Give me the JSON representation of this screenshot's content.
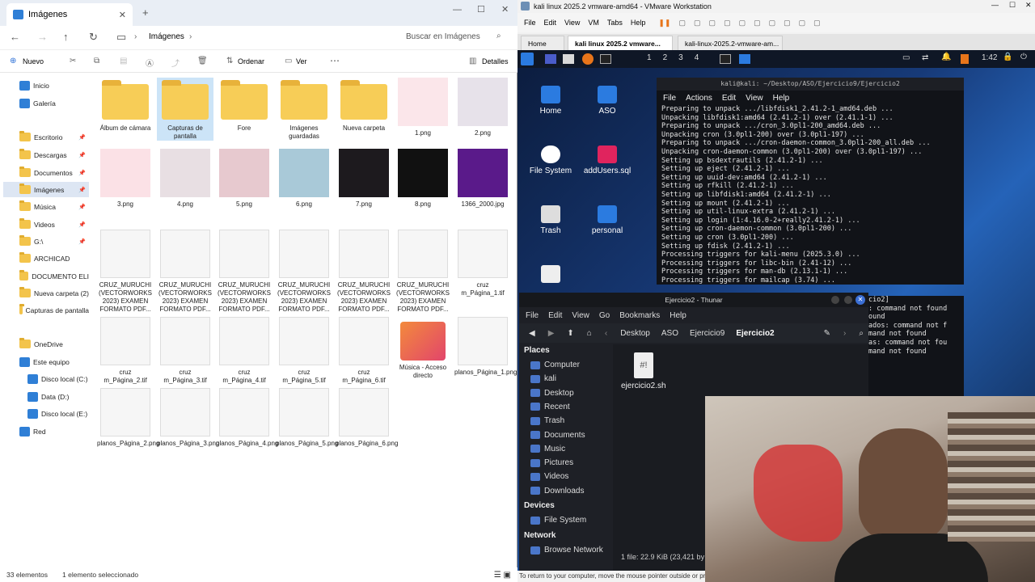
{
  "explorer": {
    "tab_title": "Imágenes",
    "breadcrumb": "Imágenes",
    "search_placeholder": "Buscar en Imágenes",
    "cmd": {
      "new": "Nuevo",
      "sort": "Ordenar",
      "view": "Ver",
      "details": "Detalles"
    },
    "nav": [
      {
        "label": "Inicio",
        "pinned": false
      },
      {
        "label": "Galería",
        "pinned": false
      },
      {
        "label": "Escritorio",
        "pinned": true
      },
      {
        "label": "Descargas",
        "pinned": true
      },
      {
        "label": "Documentos",
        "pinned": true
      },
      {
        "label": "Imágenes",
        "pinned": true
      },
      {
        "label": "Música",
        "pinned": true
      },
      {
        "label": "Videos",
        "pinned": true
      },
      {
        "label": "G:\\",
        "pinned": true
      },
      {
        "label": "ARCHICAD",
        "pinned": false
      },
      {
        "label": "DOCUMENTO ELI",
        "pinned": false
      },
      {
        "label": "Nueva carpeta (2)",
        "pinned": false
      },
      {
        "label": "Capturas de pantalla",
        "pinned": false
      },
      {
        "label": "OneDrive",
        "pinned": false
      },
      {
        "label": "Este equipo",
        "pinned": false
      },
      {
        "label": "Disco local (C:)",
        "pinned": false
      },
      {
        "label": "Data (D:)",
        "pinned": false
      },
      {
        "label": "Disco local (E:)",
        "pinned": false
      },
      {
        "label": "Red",
        "pinned": false
      }
    ],
    "files": [
      "Álbum de cámara",
      "Capturas de pantalla",
      "Fore",
      "Imágenes guardadas",
      "Nueva carpeta",
      "1.png",
      "2.png",
      "3.png",
      "4.png",
      "5.png",
      "6.png",
      "7.png",
      "8.png",
      "1366_2000.jpg",
      "CRUZ_MURUCHI (VECTORWORKS 2023) EXAMEN FORMATO PDF...",
      "CRUZ_MURUCHI (VECTORWORKS 2023) EXAMEN FORMATO PDF...",
      "CRUZ_MURUCHI (VECTORWORKS 2023) EXAMEN FORMATO PDF...",
      "CRUZ_MURUCHI (VECTORWORKS 2023) EXAMEN FORMATO PDF...",
      "CRUZ_MURUCHI (VECTORWORKS 2023) EXAMEN FORMATO PDF...",
      "CRUZ_MURUCHI (VECTORWORKS 2023) EXAMEN FORMATO PDF...",
      "cruz m_Página_1.tif",
      "cruz m_Página_2.tif",
      "cruz m_Página_3.tif",
      "cruz m_Página_4.tif",
      "cruz m_Página_5.tif",
      "cruz m_Página_6.tif",
      "Música - Acceso directo",
      "planos_Página_1.png",
      "planos_Página_2.png",
      "planos_Página_3.png",
      "planos_Página_4.png",
      "planos_Página_5.png",
      "planos_Página_6.png"
    ],
    "status": {
      "count": "33 elementos",
      "selected": "1 elemento seleccionado"
    }
  },
  "vmware": {
    "title": "kali linux 2025.2 vmware-amd64 - VMware Workstation",
    "menu": [
      "File",
      "Edit",
      "View",
      "VM",
      "Tabs",
      "Help"
    ],
    "tabs": [
      "Home",
      "kali linux 2025.2 vmware...",
      "kali-linux-2025.2-vmware-am..."
    ],
    "status": "To return to your computer, move the mouse pointer outside or press Ctrl+Alt."
  },
  "kali": {
    "workspaces": [
      "1",
      "2",
      "3",
      "4"
    ],
    "clock": "1:42",
    "desktop_icons": [
      "Home",
      "ASO",
      "File System",
      "addUsers.sql",
      "Trash",
      "personal"
    ],
    "terminal": {
      "title": "kali@kali: ~/Desktop/ASO/Ejercicio9/Ejercicio2",
      "menu": [
        "File",
        "Actions",
        "Edit",
        "View",
        "Help"
      ],
      "lines": [
        "Preparing to unpack .../libfdisk1_2.41.2-1_amd64.deb ...",
        "Unpacking libfdisk1:amd64 (2.41.2-1) over (2.41.1-1) ...",
        "Preparing to unpack .../cron_3.0pl1-200_amd64.deb ...",
        "Unpacking cron (3.0pl1-200) over (3.0pl1-197) ...",
        "Preparing to unpack .../cron-daemon-common_3.0pl1-200_all.deb ...",
        "Unpacking cron-daemon-common (3.0pl1-200) over (3.0pl1-197) ...",
        "Setting up bsdextrautils (2.41.2-1) ...",
        "Setting up eject (2.41.2-1) ...",
        "Setting up uuid-dev:amd64 (2.41.2-1) ...",
        "Setting up rfkill (2.41.2-1) ...",
        "Setting up libfdisk1:amd64 (2.41.2-1) ...",
        "Setting up mount (2.41.2-1) ...",
        "Setting up util-linux-extra (2.41.2-1) ...",
        "Setting up login (1:4.16.0-2+really2.41.2-1) ...",
        "Setting up cron-daemon-common (3.0pl1-200) ...",
        "Setting up cron (3.0pl1-200) ...",
        "Setting up fdisk (2.41.2-1) ...",
        "Processing triggers for kali-menu (2025.3.0) ...",
        "Processing triggers for libc-bin (2.41-12) ...",
        "Processing triggers for man-db (2.13.1-1) ...",
        "Processing triggers for mailcap (3.74) ..."
      ],
      "lines2": [
        "cio2]",
        ": command not found",
        "ound",
        "ados: command not f",
        "",
        "mand not found",
        "as: command not fou",
        "",
        "mand not found"
      ]
    },
    "thunar": {
      "title": "Ejercicio2 - Thunar",
      "menu": [
        "File",
        "Edit",
        "View",
        "Go",
        "Bookmarks",
        "Help"
      ],
      "path": [
        "Desktop",
        "ASO",
        "Ejercicio9",
        "Ejercicio2"
      ],
      "places_header": "Places",
      "places": [
        "Computer",
        "kali",
        "Desktop",
        "Recent",
        "Trash",
        "Documents",
        "Music",
        "Pictures",
        "Videos",
        "Downloads"
      ],
      "devices_header": "Devices",
      "devices": [
        "File System"
      ],
      "network_header": "Network",
      "network": [
        "Browse Network"
      ],
      "file": "ejercicio2.sh",
      "status": "1 file: 22.9 KiB (23,421 by"
    }
  }
}
